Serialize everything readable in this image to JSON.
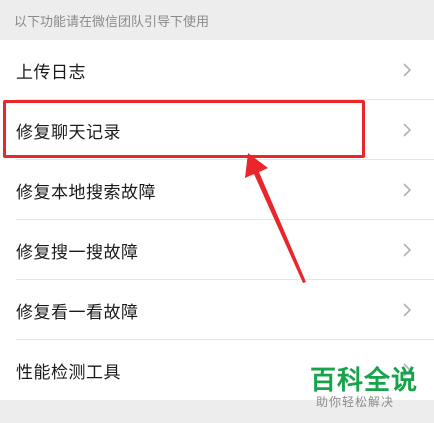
{
  "section_header": "以下功能请在微信团队引导下使用",
  "items": [
    {
      "label": "上传日志"
    },
    {
      "label": "修复聊天记录"
    },
    {
      "label": "修复本地搜索故障"
    },
    {
      "label": "修复搜一搜故障"
    },
    {
      "label": "修复看一看故障"
    },
    {
      "label": "性能检测工具"
    }
  ],
  "icons": {
    "chevron": "chevron-right-icon"
  },
  "colors": {
    "highlight": "#e8262c",
    "watermark": "#16a34a",
    "background": "#ededed"
  },
  "watermark": {
    "main": "百科全说",
    "sub": "助你轻松解决"
  }
}
